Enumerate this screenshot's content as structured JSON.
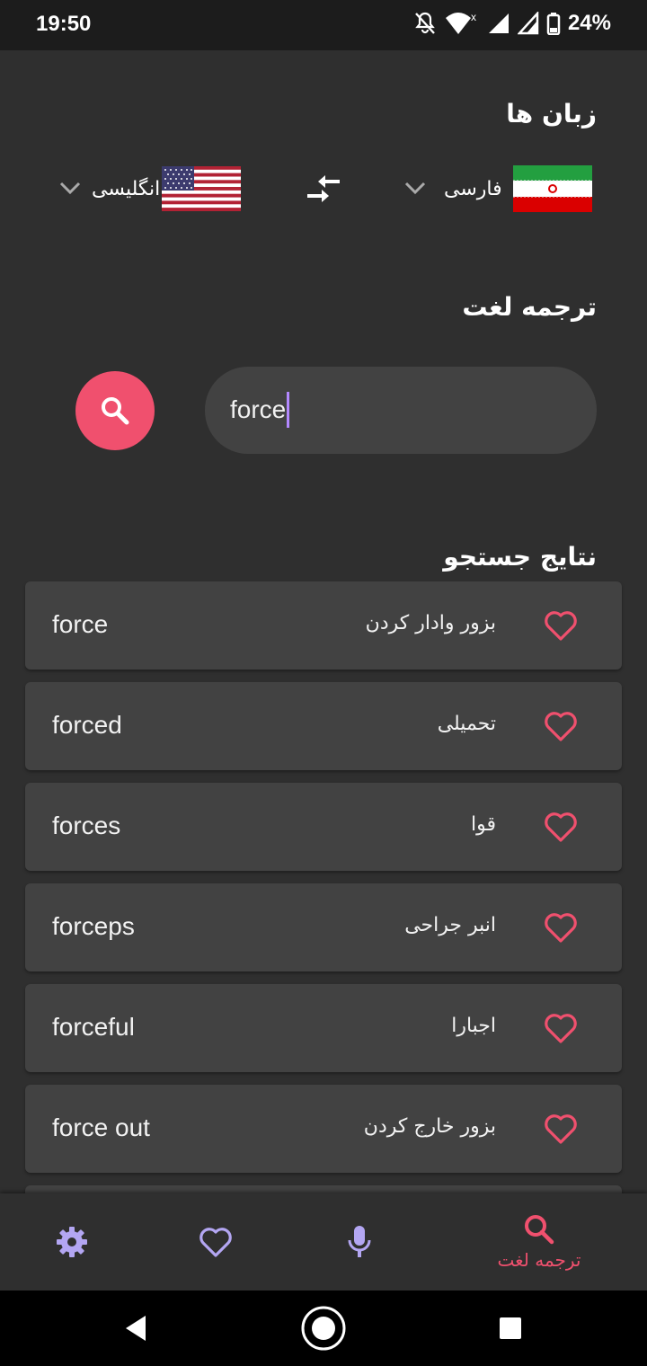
{
  "status_bar": {
    "time": "19:50",
    "battery": "24%"
  },
  "languages": {
    "title": "زبان ها",
    "source": {
      "label": "فارسی",
      "flag": "iran-flag"
    },
    "target": {
      "label": "انگلیسی",
      "flag": "us-flag"
    }
  },
  "translate": {
    "title": "ترجمه لغت",
    "search_value": "force"
  },
  "results": {
    "title": "نتایج جستجو",
    "items": [
      {
        "en": "force",
        "fa": "بزور وادار کردن"
      },
      {
        "en": "forced",
        "fa": "تحمیلی"
      },
      {
        "en": "forces",
        "fa": "قوا"
      },
      {
        "en": "forceps",
        "fa": "انبر جراحی"
      },
      {
        "en": "forceful",
        "fa": "اجبارا"
      },
      {
        "en": "force out",
        "fa": "بزور خارج کردن"
      }
    ]
  },
  "bottom_nav": {
    "active_label": "ترجمه لغت"
  },
  "colors": {
    "accent": "#f0506e",
    "nav_inactive": "#b3a6f2",
    "background": "#2f2f2f",
    "card": "#424242"
  }
}
